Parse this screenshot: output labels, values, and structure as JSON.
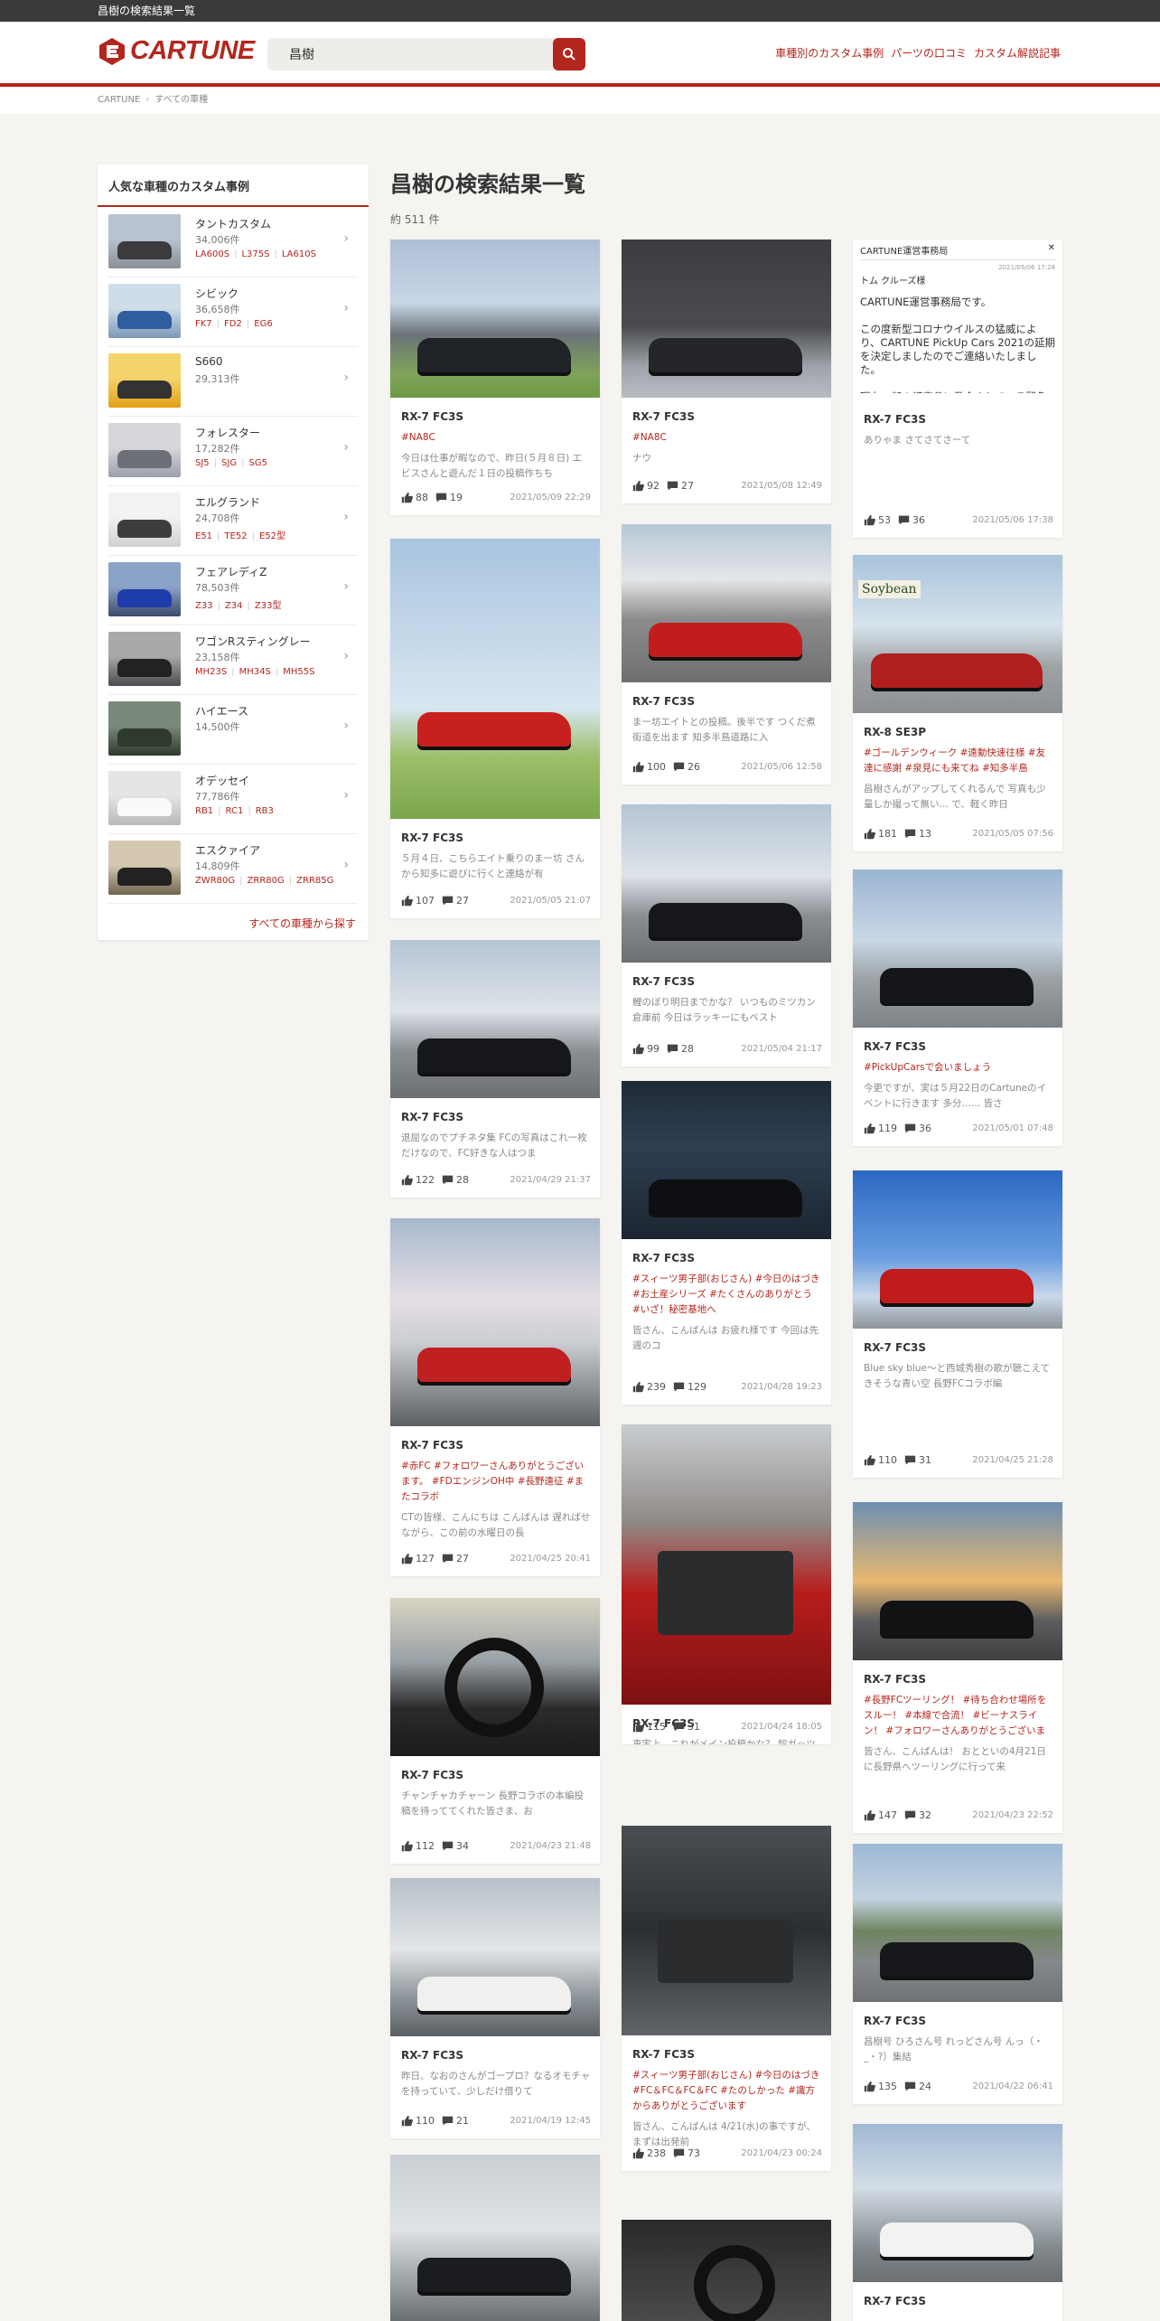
{
  "topbar": {
    "title": "昌樹の検索結果一覧"
  },
  "header": {
    "logo": "CARTUNE",
    "search_value": "昌樹",
    "nav": [
      "車種別のカスタム事例",
      "パーツの口コミ",
      "カスタム解説記事"
    ]
  },
  "breadcrumb": [
    "CARTUNE",
    "すべての車種"
  ],
  "sidebar": {
    "title": "人気な車種のカスタム事例",
    "link": "すべての車種から探す",
    "items": [
      {
        "name": "タントカスタム",
        "count": "34,006件",
        "codes": [
          "LA600S",
          "L375S",
          "LA610S"
        ]
      },
      {
        "name": "シビック",
        "count": "36,658件",
        "codes": [
          "FK7",
          "FD2",
          "EG6"
        ]
      },
      {
        "name": "S660",
        "count": "29,313件",
        "codes": []
      },
      {
        "name": "フォレスター",
        "count": "17,282件",
        "codes": [
          "SJ5",
          "SJG",
          "SG5"
        ]
      },
      {
        "name": "エルグランド",
        "count": "24,708件",
        "codes": [
          "E51",
          "TE52",
          "E52型"
        ]
      },
      {
        "name": "フェアレディZ",
        "count": "78,503件",
        "codes": [
          "Z33",
          "Z34",
          "Z33型"
        ]
      },
      {
        "name": "ワゴンRスティングレー",
        "count": "23,158件",
        "codes": [
          "MH23S",
          "MH34S",
          "MH55S"
        ]
      },
      {
        "name": "ハイエース",
        "count": "14,500件",
        "codes": []
      },
      {
        "name": "オデッセイ",
        "count": "77,786件",
        "codes": [
          "RB1",
          "RC1",
          "RB3"
        ]
      },
      {
        "name": "エスクァイア",
        "count": "14,809件",
        "codes": [
          "ZWR80G",
          "ZRR80G",
          "ZRR85G"
        ]
      }
    ]
  },
  "main": {
    "heading": "昌樹の検索結果一覧",
    "count": "約 511 件"
  },
  "posts": [
    {
      "model": "RX-7 FC3S",
      "tags": "#NA8C",
      "excerpt": "今日は仕事が暇なので、昨日(５月８日) エビスさんと遊んだ１日の投稿作ちち",
      "likes": "88",
      "comments": "19",
      "date": "2021/05/09 22:29"
    },
    {
      "model": "RX-7 FC3S",
      "tags": "",
      "excerpt": "５月４日、こちらエイト乗りのまー坊 さんから知多に遊びに行くと連絡が有",
      "likes": "107",
      "comments": "27",
      "date": "2021/05/05 21:07"
    },
    {
      "model": "RX-7 FC3S",
      "tags": "",
      "excerpt": "退屈なのでプチネタ集 FCの写真はこれ一枚だけなので、FC好きな人はつま",
      "likes": "122",
      "comments": "28",
      "date": "2021/04/29 21:37"
    },
    {
      "model": "RX-7 FC3S",
      "tags": "#赤FC #フォロワーさんありがとうございます。 #FDエンジンOH中 #長野遠征 #またコラボ",
      "excerpt": "CTの皆様、こんにちは こんばんは 遅ればせながら、この前の水曜日の長",
      "likes": "127",
      "comments": "27",
      "date": "2021/04/25 20:41"
    },
    {
      "model": "RX-7 FC3S",
      "tags": "",
      "excerpt": "チャンチャカチャーン 長野コラボの本編投稿を待っててくれた皆さま、お",
      "likes": "112",
      "comments": "34",
      "date": "2021/04/23 21:48"
    },
    {
      "model": "RX-7 FC3S",
      "tags": "",
      "excerpt": "昨日、なおのさんがゴープロ？なるオモチャを持っていて、少しだけ借りて",
      "likes": "110",
      "comments": "21",
      "date": "2021/04/19 12:45"
    },
    {
      "model": "RX-7 FC3S",
      "tags": "#NA8C",
      "excerpt": "ナウ",
      "likes": "92",
      "comments": "27",
      "date": "2021/05/08 12:49"
    },
    {
      "model": "RX-7 FC3S",
      "tags": "",
      "excerpt": "まー坊エイトとの投稿。後半です つくだ煮街道を出ます 知多半島道路に入",
      "likes": "100",
      "comments": "26",
      "date": "2021/05/06 12:58"
    },
    {
      "model": "RX-7 FC3S",
      "tags": "",
      "excerpt": "鯉のぼり明日までかな？ いつものミツカン倉庫前 今日はラッキーにもベスト",
      "likes": "99",
      "comments": "28",
      "date": "2021/05/04 21:17"
    },
    {
      "model": "RX-7 FC3S",
      "tags": "#スィーツ男子部(おじさん) #今日のはづき #お土産シリーズ #たくさんのありがとう #いざ！秘密基地へ",
      "excerpt": "皆さん、こんばんは お疲れ様です 今回は先週のコ",
      "likes": "239",
      "comments": "129",
      "date": "2021/04/28 19:23"
    },
    {
      "model": "RX-7 FC3S",
      "tags": "",
      "excerpt": "事実上、これがメイン投稿かな？ 超ガッツリ載せますよー FC写真しか無い",
      "likes": "115",
      "comments": "31",
      "date": "2021/04/24 18:05"
    },
    {
      "model": "RX-7 FC3S",
      "tags": "#スィーツ男子部(おじさん) #今日のはづき #FC＆FC＆FC＆FC #たのしかった #識方からありがとうございます",
      "excerpt": "皆さん、こんばんは 4/21(水)の事ですが、まずは出発前",
      "likes": "238",
      "comments": "73",
      "date": "2021/04/23 00:24"
    },
    {
      "model": "RX-7 FC3S",
      "tags": "",
      "excerpt": "ありゃま さてさてさーて",
      "likes": "53",
      "comments": "36",
      "date": "2021/05/06 17:38"
    },
    {
      "model": "RX-8 SE3P",
      "tags": "#ゴールデンウィーク #遠動快速往様 #友達に感謝 #泉見にも来てね #知多半島",
      "excerpt": "昌樹さんがアップしてくれるんで 写真も少量しか撮って無い… で、軽く昨日",
      "likes": "181",
      "comments": "13",
      "date": "2021/05/05 07:56"
    },
    {
      "model": "RX-7 FC3S",
      "tags": "#PickUpCarsで会いましょう",
      "excerpt": "今更ですが、実は５月22日のCartuneのイベントに行きます 多分…… 皆さ",
      "likes": "119",
      "comments": "36",
      "date": "2021/05/01 07:48"
    },
    {
      "model": "RX-7 FC3S",
      "tags": "",
      "excerpt": "Blue sky blue～と西城秀樹の歌が聴こえてきそうな青い空 長野FCコラボ編",
      "likes": "110",
      "comments": "31",
      "date": "2021/04/25 21:28"
    },
    {
      "model": "RX-7 FC3S",
      "tags": "#長野FCツーリング！ #待ち合わせ場所をスルー！ #本線で合流！ #ビーナスライン！ #フォロワーさんありがとうございます！",
      "excerpt": "皆さん、こんばんは！ おとといの4月21日に長野県へツーリングに行って来",
      "likes": "147",
      "comments": "32",
      "date": "2021/04/23 22:52"
    },
    {
      "model": "RX-7 FC3S",
      "tags": "",
      "excerpt": "昌樹号 ひろさん号 れっどさん号 んっ（・_・?）集結",
      "likes": "135",
      "comments": "24",
      "date": "2021/04/22 06:41"
    },
    {
      "model": "RX-7 FC3S",
      "tags": "",
      "excerpt": "",
      "likes": "",
      "comments": "",
      "date": ""
    }
  ],
  "post_notice": {
    "header": "CARTUNE運営事務局",
    "date": "2021/05/06 17:24",
    "to": "トム クルーズ様",
    "body": "CARTUNE運営事務局です。\n\nこの度新型コロナウイルスの猛威により、CARTUNE PickUp Cars 2021の延期を決定しましたのでご連絡いたしました。\n\n現在一部の都府県に発令されている緊急事態宣言につきまして、"
  },
  "photo_sign": "Soybean",
  "colors": {
    "accent": "#b3261e",
    "topbar": "#3a3a3a",
    "bg": "#f5f4f1"
  },
  "icons": {
    "like": "thumbs-up-icon",
    "comment": "comment-icon",
    "search": "search-icon",
    "chevron": "chevron-right-icon"
  }
}
